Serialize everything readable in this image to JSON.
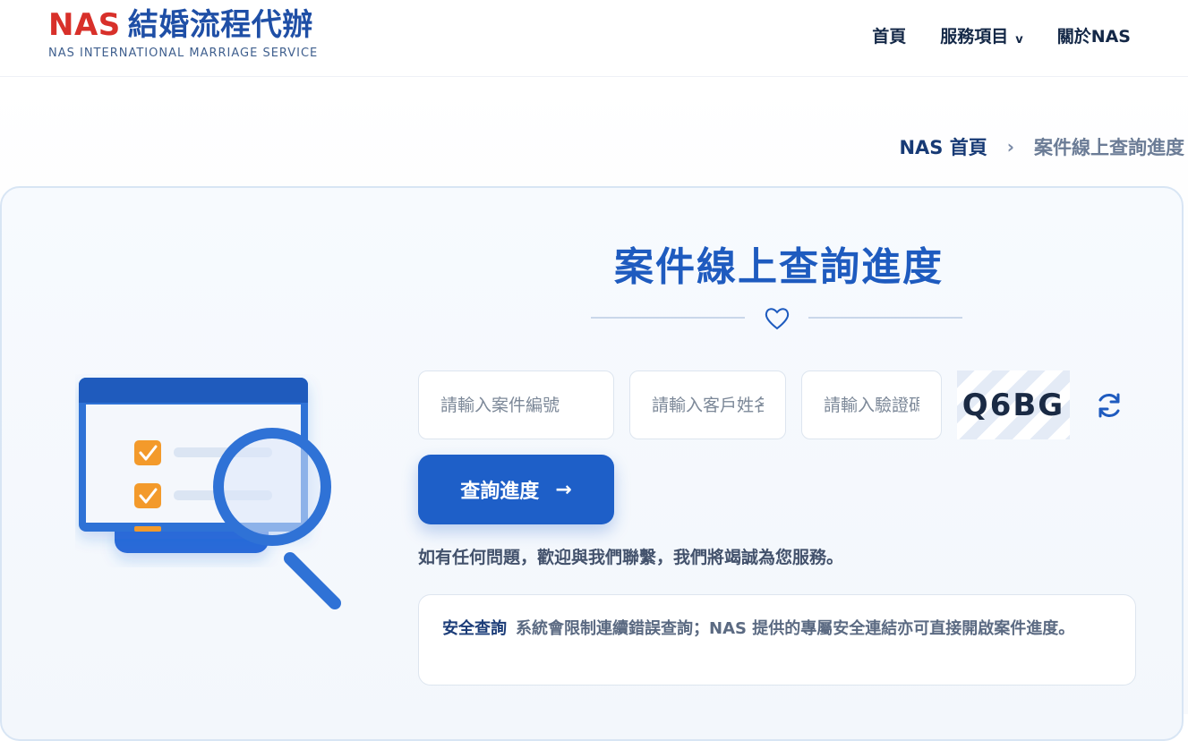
{
  "header": {
    "logo_nas": "NAS",
    "logo_cn": "結婚流程代辦",
    "logo_sub": "NAS INTERNATIONAL MARRIAGE SERVICE",
    "nav": [
      {
        "label": "首頁"
      },
      {
        "label": "服務項目",
        "caret": "v"
      },
      {
        "label": "關於NAS"
      }
    ]
  },
  "breadcrumb": {
    "home": "NAS 首頁",
    "separator": "›",
    "current": "案件線上查詢進度"
  },
  "main": {
    "title": "案件線上查詢進度",
    "heart_icon": "heart-outline-icon",
    "inputs": {
      "case_placeholder": "請輸入案件編號",
      "name_placeholder": "請輸入客戶姓名",
      "code_placeholder": "請輸入驗證碼"
    },
    "captcha": "Q6BG",
    "refresh_icon": "refresh-icon",
    "submit_label": "查詢進度",
    "submit_arrow": "→",
    "help_text": "如有任何問題，歡迎與我們聯繫，我們將竭誠為您服務。",
    "notice_label": "安全查詢",
    "notice_text": "系統會限制連續錯誤查詢；NAS 提供的專屬安全連結亦可直接開啟案件進度。"
  },
  "colors": {
    "brand_red": "#d8302a",
    "brand_blue": "#1f4fa6",
    "button_blue": "#1e5fc8",
    "check_orange": "#f39a2b"
  }
}
